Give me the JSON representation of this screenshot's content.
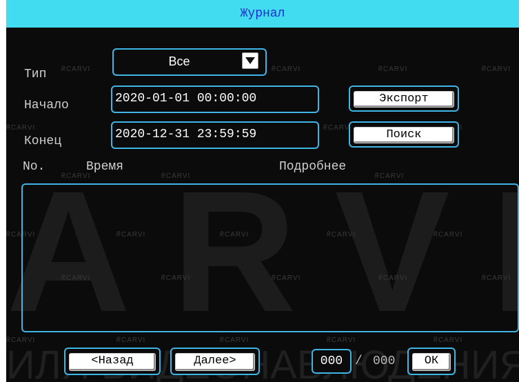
{
  "title": "Журнал",
  "watermark": {
    "big_text": "ARVI",
    "small_text": "ᖇCARVI",
    "bottom_text": "ИЛЯ ВИДЕОНАБЛЮДЕНИЯ"
  },
  "filters": {
    "type_label": "Тип",
    "type_value": "Все",
    "start_label": "Начало",
    "start_value": "2020-01-01 00:00:00",
    "end_label": "Конец",
    "end_value": "2020-12-31 23:59:59"
  },
  "buttons": {
    "export": "Экспорт",
    "search": "Поиск",
    "back": "<Назад",
    "next": "Далее>",
    "ok": "ОК"
  },
  "table": {
    "columns": [
      "No.",
      "Время",
      "Подробнее"
    ],
    "rows": []
  },
  "pagination": {
    "current": "000",
    "separator": "/",
    "total": "000"
  },
  "colors": {
    "titlebar_bg": "#41dcf0",
    "title_text": "#1f2cd6",
    "accent_border": "#3fb6e6",
    "background": "#0b0b0b"
  }
}
